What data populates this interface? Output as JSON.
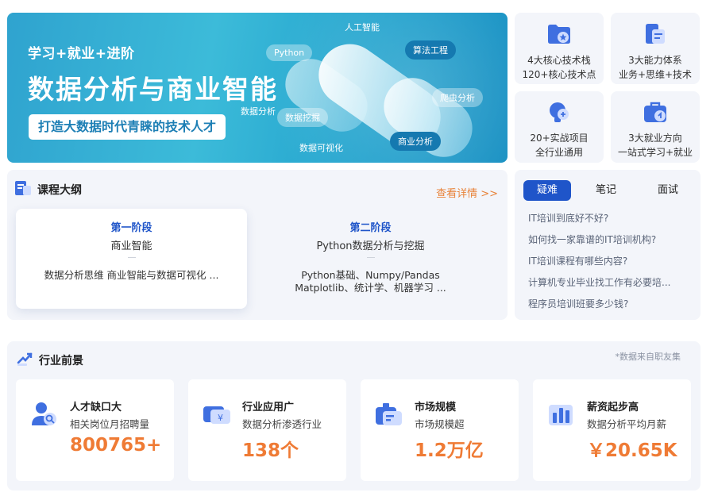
{
  "banner": {
    "tagline": "学习+就业+进阶",
    "title": "数据分析与商业智能",
    "slogan": "打造大数据时代青睐的技术人才",
    "tags": [
      "人工智能",
      "Python",
      "算法工程",
      "数据分析",
      "数据挖掘",
      "爬虫分析",
      "数据可视化",
      "商业分析"
    ]
  },
  "tiles": [
    {
      "icon": "folder-star-icon",
      "line1": "4大核心技术栈",
      "line2": "120+核心技术点"
    },
    {
      "icon": "document-folder-icon",
      "line1": "3大能力体系",
      "line2": "业务+思维+技术"
    },
    {
      "icon": "lightbulb-icon",
      "line1": "20+实战项目",
      "line2": "全行业通用"
    },
    {
      "icon": "briefcase-icon",
      "line1": "3大就业方向",
      "line2": "一站式学习+就业"
    }
  ],
  "outline": {
    "title": "课程大纲",
    "more": "查看详情 >>",
    "stages": [
      {
        "name": "第一阶段",
        "subtitle": "商业智能",
        "desc": "数据分析思维 商业智能与数据可视化 ..."
      },
      {
        "name": "第二阶段",
        "subtitle": "Python数据分析与挖掘",
        "desc": "Python基础、Numpy/Pandas Matplotlib、统计学、机器学习 ..."
      }
    ]
  },
  "faq": {
    "tabs": [
      "疑难",
      "笔记",
      "面试"
    ],
    "questions": [
      "IT培训到底好不好?",
      "如何找一家靠谱的IT培训机构?",
      "IT培训课程有哪些内容?",
      "计算机专业毕业找工作有必要培...",
      "程序员培训班要多少钱?"
    ]
  },
  "prospects": {
    "title": "行业前景",
    "note": "*数据来自职友集",
    "stats": [
      {
        "icon": "user-search-icon",
        "title": "人才缺口大",
        "subtitle": "相关岗位月招聘量",
        "value": "800765+"
      },
      {
        "icon": "yen-card-icon",
        "title": "行业应用广",
        "subtitle": "数据分析渗透行业",
        "value": "138个"
      },
      {
        "icon": "id-card-icon",
        "title": "市场规模",
        "subtitle": "市场规模超",
        "value": "1.2万亿"
      },
      {
        "icon": "bar-chart-icon",
        "title": "薪资起步高",
        "subtitle": "数据分析平均月薪",
        "value": "￥20.65K"
      }
    ]
  },
  "colors": {
    "accent_blue": "#1f55c9",
    "accent_orange": "#ef7b35",
    "panel_bg": "#f3f5fa"
  }
}
